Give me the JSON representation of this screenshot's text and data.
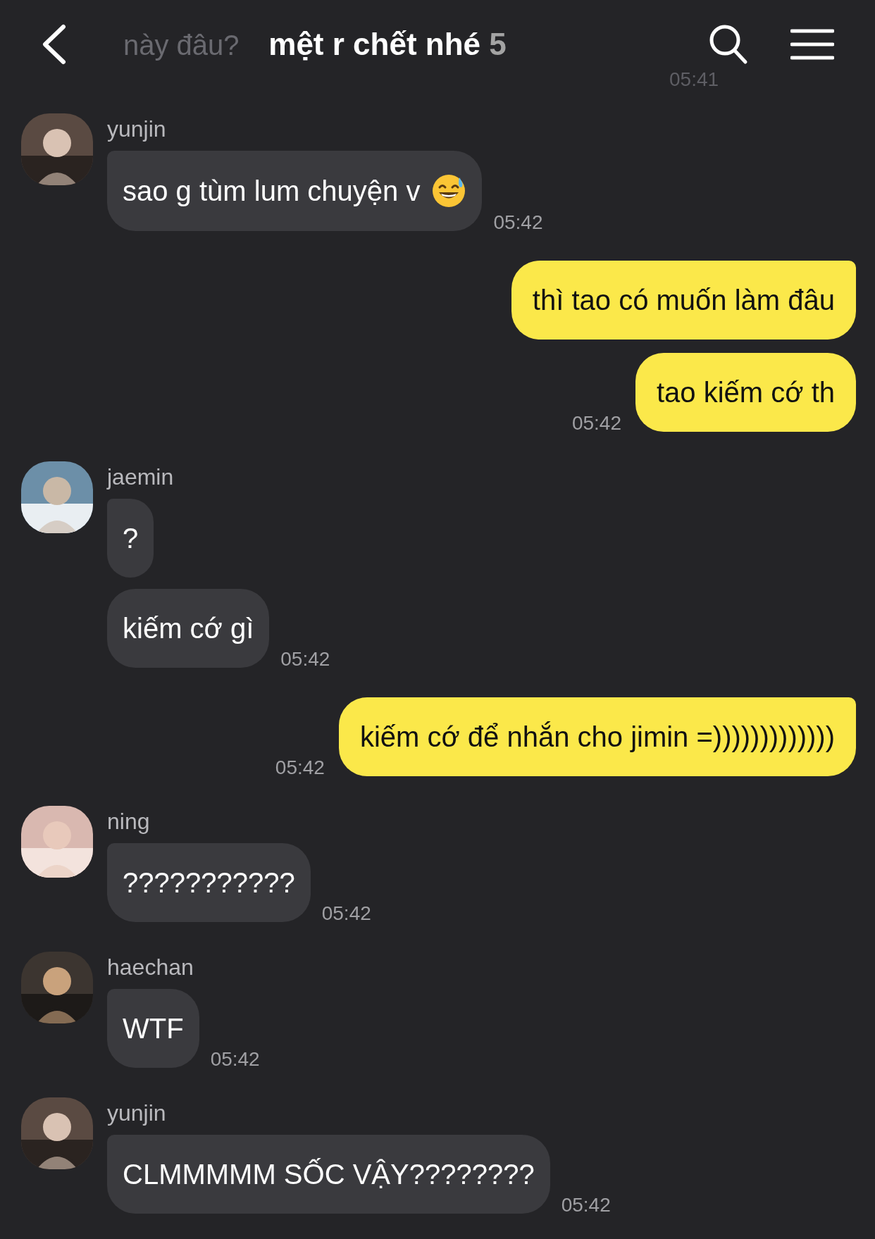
{
  "header": {
    "title": "mệt r chết nhé",
    "member_count": "5"
  },
  "faded_message": {
    "text": "này đâu?",
    "time": "05:41"
  },
  "messages": [
    {
      "kind": "received",
      "sender": "yunjin",
      "avatar": {
        "kind": "picture"
      },
      "bubbles": [
        {
          "kind": "text_with_emoji",
          "text": "sao g tùm lum chuyện v"
        }
      ],
      "time": "05:42"
    },
    {
      "kind": "sent",
      "bubbles": [
        {
          "text": "thì tao có muốn làm đâu"
        },
        {
          "text": "tao kiếm cớ th"
        }
      ],
      "time": "05:42"
    },
    {
      "kind": "received",
      "sender": "jaemin",
      "avatar": {
        "kind": "picture"
      },
      "bubbles": [
        {
          "text": "?"
        },
        {
          "text": "kiếm cớ gì"
        }
      ],
      "time": "05:42"
    },
    {
      "kind": "sent",
      "bubbles": [
        {
          "text": "kiếm cớ để nhắn cho jimin =)))))))))))))"
        }
      ],
      "time": "05:42"
    },
    {
      "kind": "received",
      "sender": "ning",
      "avatar": {
        "kind": "picture"
      },
      "bubbles": [
        {
          "text": "???????????"
        }
      ],
      "time": "05:42"
    },
    {
      "kind": "received",
      "sender": "haechan",
      "avatar": {
        "kind": "picture"
      },
      "bubbles": [
        {
          "text": "WTF"
        }
      ],
      "time": "05:42"
    },
    {
      "kind": "received",
      "sender": "yunjin",
      "avatar": {
        "kind": "picture"
      },
      "bubbles": [
        {
          "text": "CLMMMMM SỐC VẬY????????"
        }
      ],
      "time": "05:42"
    }
  ]
}
